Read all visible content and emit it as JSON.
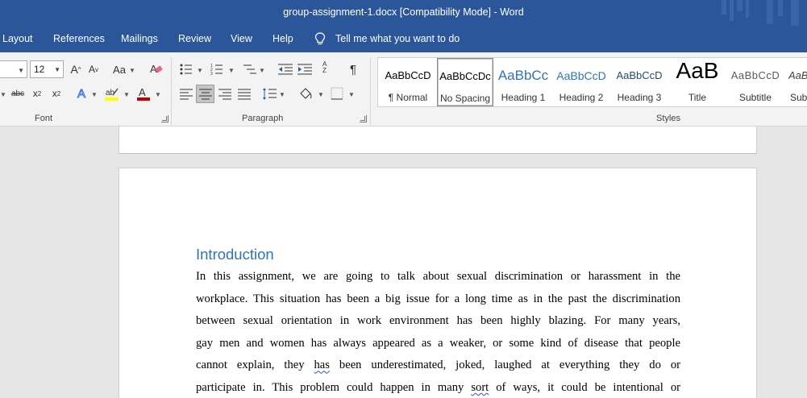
{
  "window": {
    "title": "group-assignment-1.docx [Compatibility Mode]  -  Word"
  },
  "tabs": [
    "Layout",
    "References",
    "Mailings",
    "Review",
    "View",
    "Help"
  ],
  "tell_me": "Tell me what you want to do",
  "font": {
    "size": "12"
  },
  "groups": {
    "font": "Font",
    "paragraph": "Paragraph",
    "styles": "Styles"
  },
  "icons": {
    "grow_font": "A",
    "shrink_font": "A",
    "change_case": "Aa",
    "strikethrough": "abc",
    "subscript": "x",
    "superscript": "x",
    "text_effects": "A",
    "font_color": "A",
    "sort": "A Z",
    "pilcrow": "¶"
  },
  "styles": [
    {
      "sample": "AaBbCcD",
      "name": "¶ Normal"
    },
    {
      "sample": "AaBbCcDc",
      "name": "No Spacing"
    },
    {
      "sample": "AaBbCc",
      "name": "Heading 1"
    },
    {
      "sample": "AaBbCcD",
      "name": "Heading 2"
    },
    {
      "sample": "AaBbCcD",
      "name": "Heading 3"
    },
    {
      "sample": "AaB",
      "name": "Title"
    },
    {
      "sample": "AaBbCcD",
      "name": "Subtitle"
    },
    {
      "sample": "AaBl",
      "name": "Subt"
    }
  ],
  "colors": {
    "accent": "#2b579a",
    "heading": "#2e74b5",
    "highlight": "#ffff00",
    "font_color": "#c00000"
  },
  "document": {
    "heading": "Introduction",
    "lines": [
      "In this assignment, we are going to talk about sexual discrimination or harassment in the",
      "workplace. This situation has been a big issue for a long time as in the past the discrimination",
      "between sexual orientation in work environment has been highly blazing. For many years,",
      "gay men and women has always appeared as a weaker, or some kind of disease that people"
    ],
    "line5": {
      "before": "cannot explain, they ",
      "flagged": "has",
      "after": " been underestimated, joked, laughed at everything they do or"
    },
    "line6": {
      "before": "participate in. This problem could happen in many ",
      "flagged": "sort",
      "after": " of ways, it could be intentional or"
    }
  }
}
